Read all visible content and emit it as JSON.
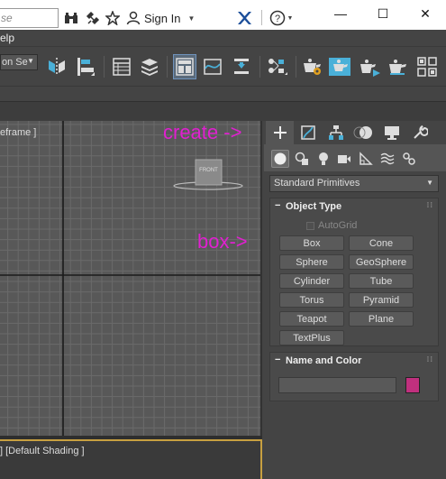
{
  "titlebar": {
    "search_text": "se",
    "signin_label": "Sign In",
    "icons": [
      "binoculars-icon",
      "satellite-icon",
      "star-icon",
      "user-icon",
      "x-exchange-icon",
      "help-icon"
    ]
  },
  "window": {
    "minimize": "—",
    "maximize": "☐",
    "close": "✕"
  },
  "menubar": {
    "help_fragment": "elp"
  },
  "toolbar": {
    "selection_set_label": "on Se"
  },
  "viewport": {
    "label": "eframe ]",
    "viewcube_label": "FRONT",
    "annotation_create": "create ->",
    "annotation_box": "box->"
  },
  "viewport2": {
    "label": "] [Default Shading ]"
  },
  "command_panel": {
    "tabs": [
      "create-tab",
      "modify-tab",
      "hierarchy-tab",
      "motion-tab",
      "display-tab",
      "utilities-tab"
    ],
    "subtabs": [
      "geometry",
      "shapes",
      "lights",
      "cameras",
      "helpers",
      "spacewarps",
      "systems"
    ],
    "primitive_dropdown": "Standard Primitives",
    "object_type": {
      "title": "Object Type",
      "autogrid_label": "AutoGrid",
      "buttons": [
        "Box",
        "Cone",
        "Sphere",
        "GeoSphere",
        "Cylinder",
        "Tube",
        "Torus",
        "Pyramid",
        "Teapot",
        "Plane",
        "TextPlus"
      ]
    },
    "name_and_color": {
      "title": "Name and Color",
      "name_value": "",
      "color": "#c0307e"
    }
  },
  "colors": {
    "annotation": "#e020d0",
    "viewport_bg": "#585858",
    "panel_bg": "#444444",
    "accent": "#4ab0d8"
  }
}
